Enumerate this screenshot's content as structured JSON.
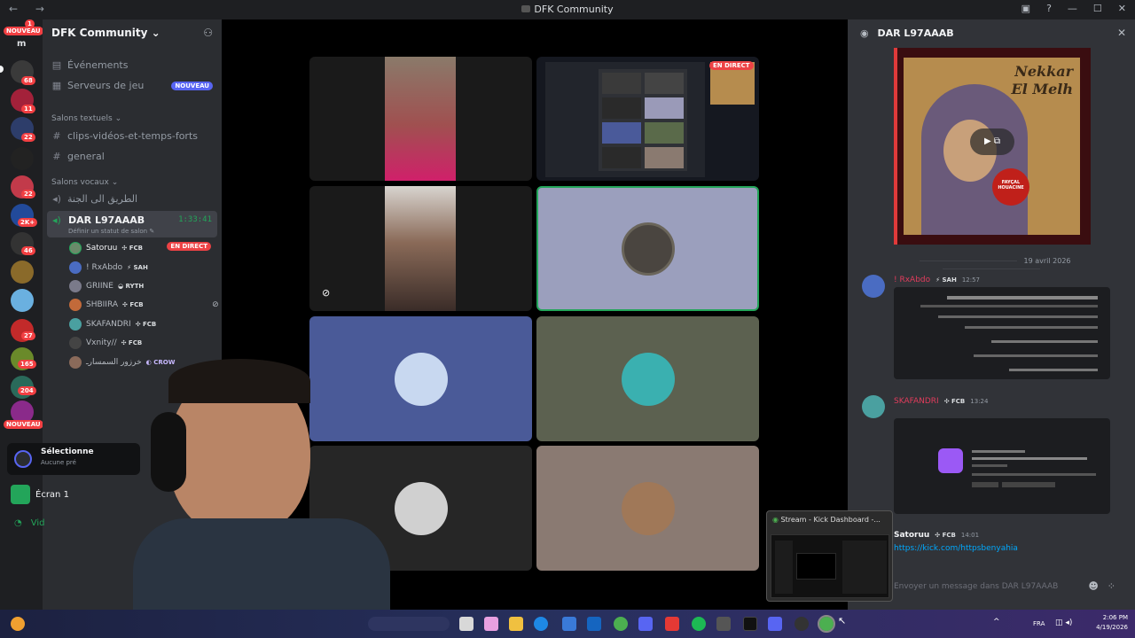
{
  "window": {
    "title": "DFK Community",
    "nav": "← →"
  },
  "rail": {
    "nouveau_top": "NOUVEAU",
    "nouveau_bottom": "NOUVEAU",
    "letter": "m",
    "top_badge": "1",
    "badges": [
      "68",
      "11",
      "22",
      "22",
      "2K+",
      "46",
      "27",
      "165",
      "204"
    ]
  },
  "guild": {
    "name": "DFK Community",
    "items": [
      {
        "label": "Événements",
        "icon": "calendar-icon"
      },
      {
        "label": "Serveurs de jeu",
        "icon": "gamepad-icon",
        "badge": "NOUVEAU"
      }
    ],
    "text_category": "Salons textuels",
    "text_channels": [
      "clips-vidéos-et-temps-forts",
      "general"
    ],
    "voice_category": "Salons vocaux",
    "voice_channels": [
      "الطريق الى الجنة"
    ],
    "active_voice": {
      "name": "DAR L97AAAB",
      "timer": "1:33:41",
      "status": "Définir un statut de salon"
    },
    "voice_users": [
      {
        "name": "Satoruu",
        "tag": "FCB",
        "live": "EN DIRECT",
        "color": "#6a8a6a"
      },
      {
        "name": "! RxAbdo",
        "tag": "SAH",
        "color": "#4a6cc2"
      },
      {
        "name": "GRIINE",
        "tag": "RYTH",
        "color": "#7a7a8a"
      },
      {
        "name": "SHBIIRA",
        "tag": "FCB",
        "color": "#c26a3a"
      },
      {
        "name": "SKAFANDRI",
        "tag": "FCB",
        "color": "#4aa0a0"
      },
      {
        "name": "Vxnity//",
        "tag": "FCB",
        "color": "#444"
      },
      {
        "name": "خرزور السمسارـ",
        "tag": "CROW",
        "color": "#8a6a5a"
      }
    ]
  },
  "stage": {
    "live_label": "EN DIRECT"
  },
  "select_popup": {
    "title": "Sélectionne",
    "subtitle": "Aucune pré"
  },
  "screen_item": "Écran 1",
  "video_item": "Vid",
  "chat": {
    "channel": "DAR L97AAAB",
    "poster_title_line1": "Nekkar",
    "poster_title_line2": "El Melh",
    "mic_label": "FAYÇAL HOUACINE",
    "date_divider": "19 avril 2026",
    "messages": [
      {
        "author": "! RxAbdo",
        "tag": "SAH",
        "time": "12:57",
        "author_color": "#e03c5c"
      },
      {
        "author": "SKAFANDRI",
        "tag": "FCB",
        "time": "13:24",
        "author_color": "#e03c5c"
      },
      {
        "author": "Satoruu",
        "tag": "FCB",
        "time": "14:01",
        "author_color": "#f2f3f5",
        "text": "https://kick.com/httpsbenyahia"
      }
    ],
    "composer_placeholder": "Envoyer un message dans DAR L97AAAB"
  },
  "stream_popup": {
    "title": "Stream - Kick Dashboard -..."
  },
  "tray": {
    "lang": "FRA",
    "time": "2:06 PM",
    "date": "4/19/2026"
  },
  "colors": {
    "accent": "#5865f2",
    "live": "#ed4245",
    "voice_green": "#23a55a"
  }
}
